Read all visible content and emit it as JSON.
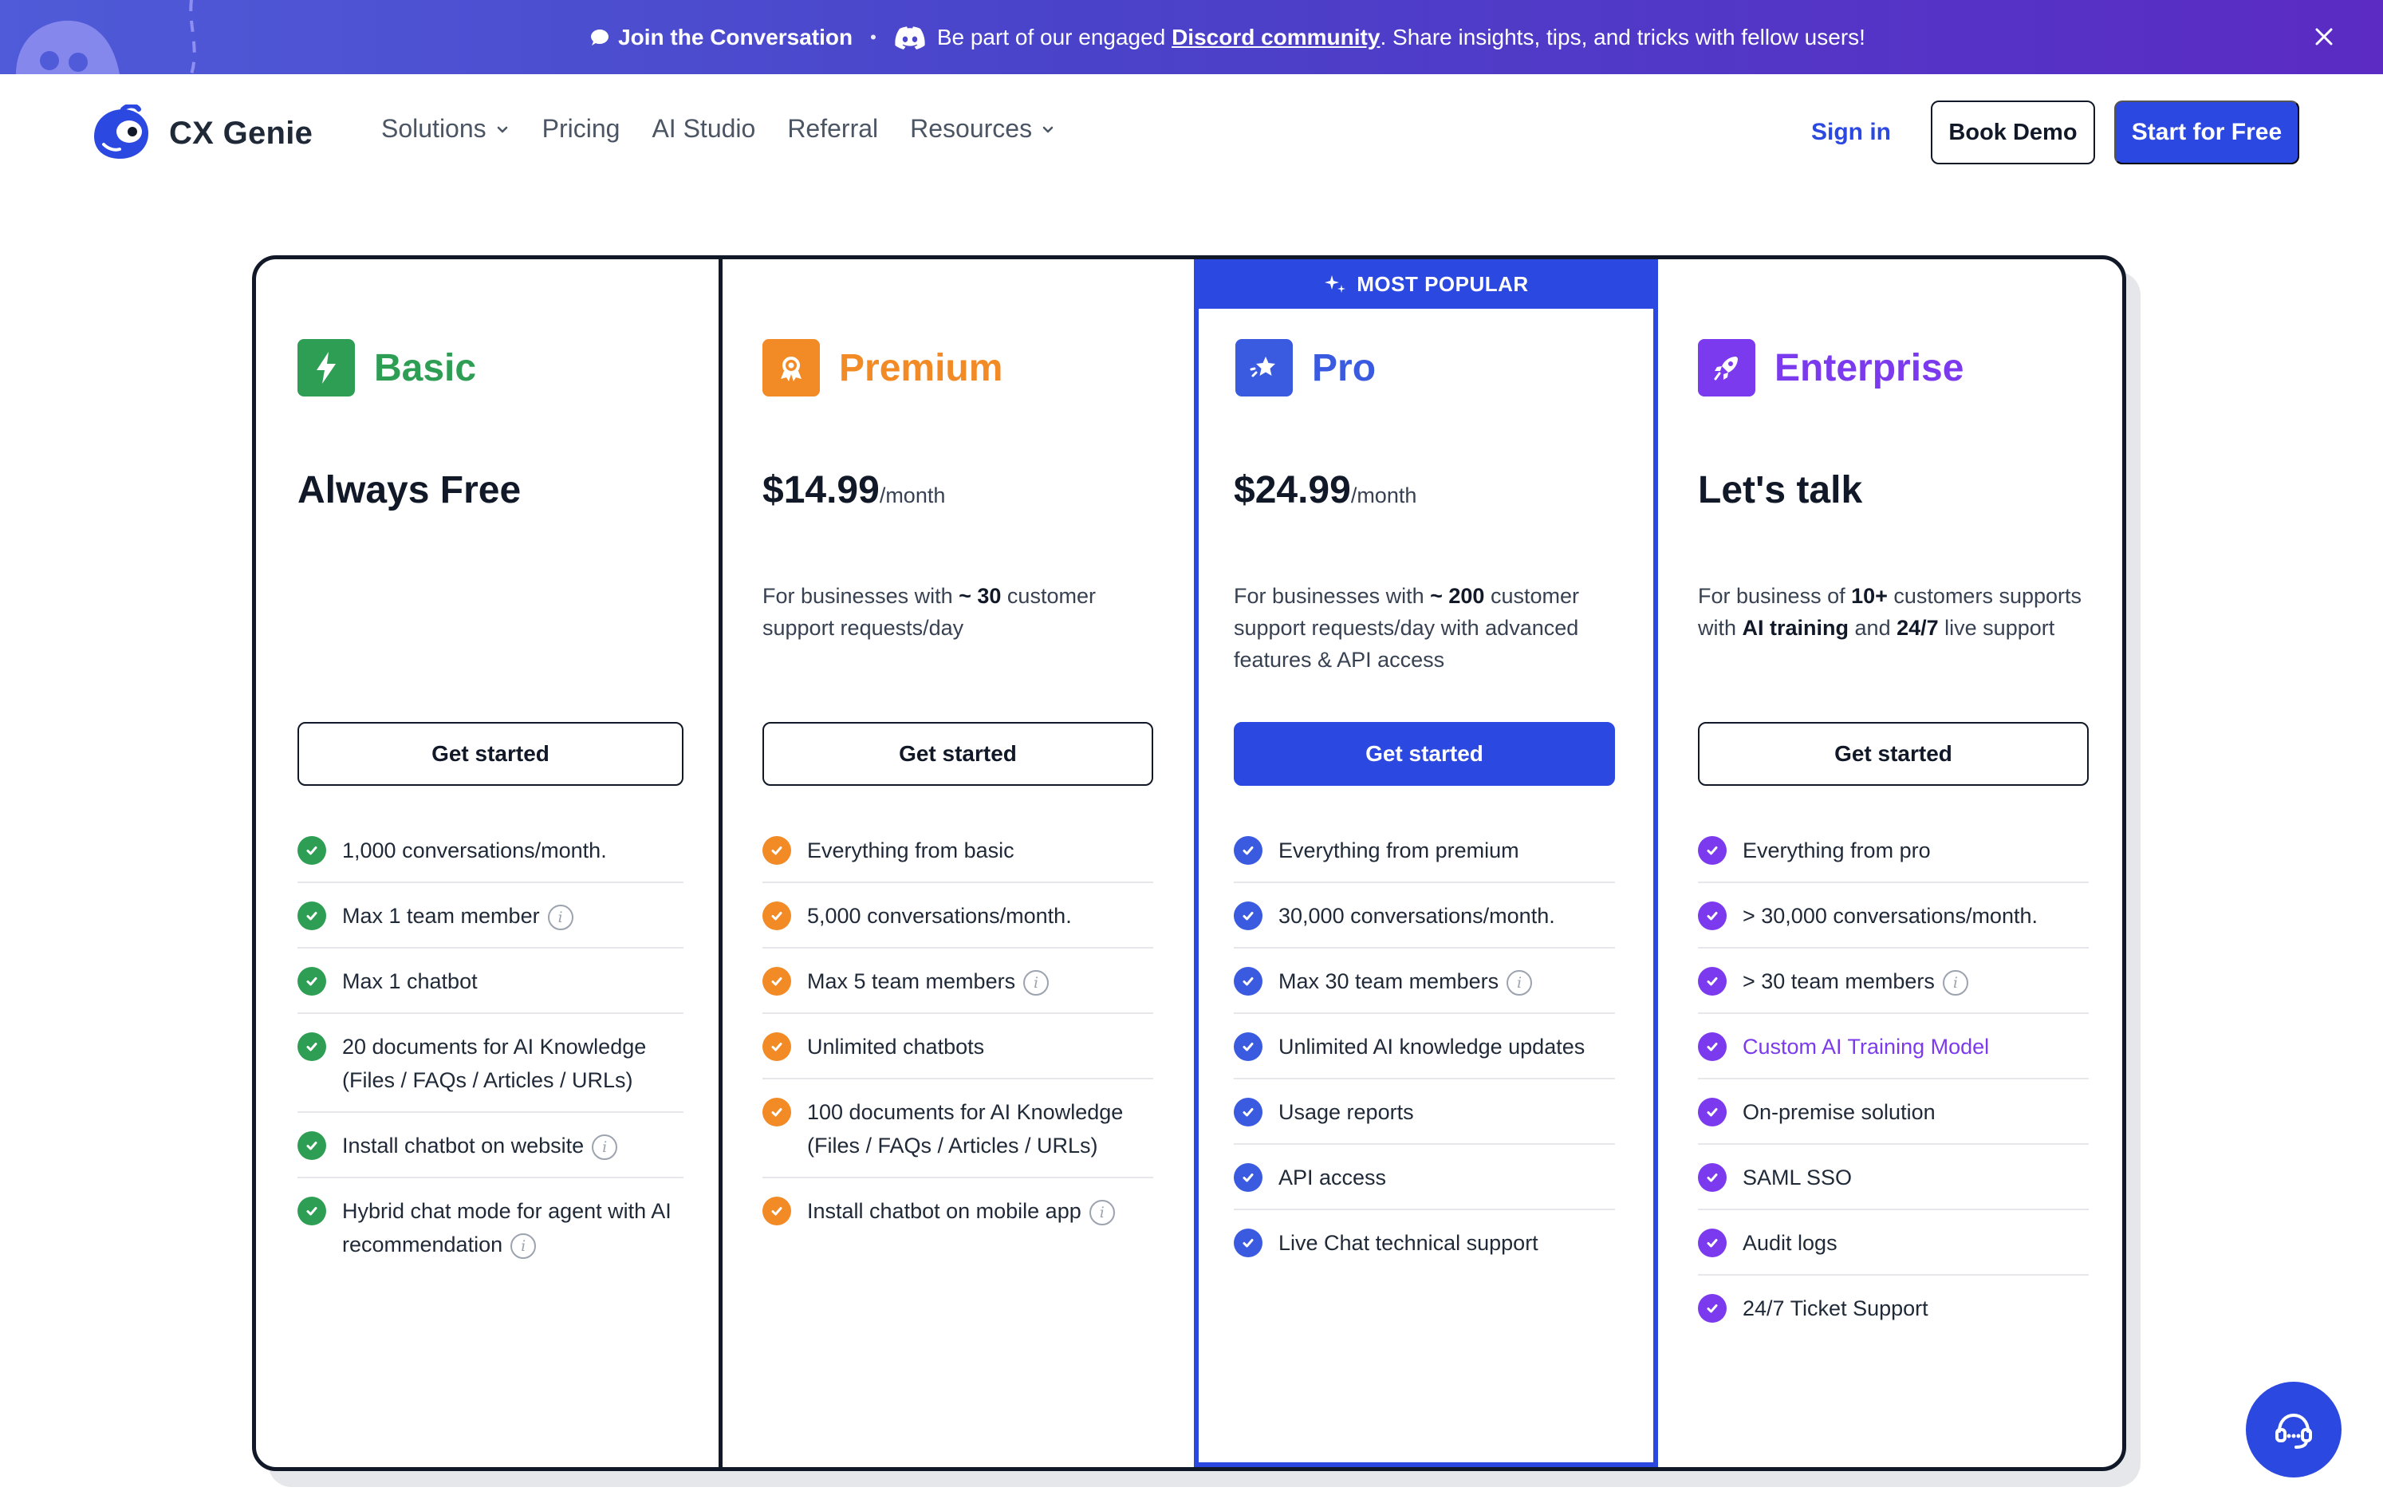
{
  "announcement": {
    "join_text": "Join the Conversation",
    "separator": "•",
    "message_prefix": "Be part of our engaged",
    "discord_link": "Discord community",
    "message_suffix": ". Share insights, tips, and tricks with fellow users!",
    "chat_icon": "speech-bubble-icon",
    "discord_icon": "discord-icon",
    "close_icon": "close-icon"
  },
  "header": {
    "logo_text": "CX Genie",
    "nav": [
      {
        "label": "Solutions",
        "has_dropdown": true
      },
      {
        "label": "Pricing",
        "has_dropdown": false
      },
      {
        "label": "AI Studio",
        "has_dropdown": false
      },
      {
        "label": "Referral",
        "has_dropdown": false
      },
      {
        "label": "Resources",
        "has_dropdown": true
      }
    ],
    "sign_in": "Sign in",
    "book_demo": "Book Demo",
    "start_free": "Start for Free"
  },
  "colors": {
    "brand_blue": "#2b48e0",
    "basic_green": "#2f9e55",
    "premium_orange": "#f28a26",
    "pro_blue": "#3a5ae0",
    "enterprise_purple": "#7b3aed"
  },
  "plans": {
    "basic": {
      "name": "Basic",
      "icon": "lightning-bolt-icon",
      "price_text": "Always Free",
      "cta": "Get started",
      "features": [
        {
          "text": "1,000 conversations/month.",
          "info": false
        },
        {
          "text": "Max 1 team member",
          "info": true
        },
        {
          "text": "Max 1 chatbot",
          "info": false
        },
        {
          "text": "20 documents for AI Knowledge (Files / FAQs / Articles / URLs)",
          "info": false
        },
        {
          "text": "Install chatbot on website",
          "info": true
        },
        {
          "text": "Hybrid chat mode for agent with AI recommendation",
          "info": true
        }
      ]
    },
    "premium": {
      "name": "Premium",
      "icon": "premium-badge-icon",
      "price": "$14.99",
      "per": "/month",
      "desc_pre": "For businesses with ",
      "desc_bold": "~ 30",
      "desc_post": " customer support requests/day",
      "cta": "Get started",
      "features": [
        {
          "text": "Everything from basic",
          "info": false
        },
        {
          "text": "5,000 conversations/month.",
          "info": false
        },
        {
          "text": "Max 5 team members",
          "info": true
        },
        {
          "text": "Unlimited chatbots",
          "info": false
        },
        {
          "text": "100 documents for AI Knowledge (Files / FAQs / Articles / URLs)",
          "info": false
        },
        {
          "text": "Install chatbot on mobile app",
          "info": true
        }
      ]
    },
    "pro": {
      "badge": "MOST POPULAR",
      "name": "Pro",
      "icon": "star-badge-icon",
      "price": "$24.99",
      "per": "/month",
      "desc_pre": "For businesses with ",
      "desc_bold": "~ 200",
      "desc_post": " customer support requests/day with advanced features & API access",
      "cta": "Get started",
      "features": [
        {
          "text": "Everything from premium",
          "info": false
        },
        {
          "text": "30,000 conversations/month.",
          "info": false
        },
        {
          "text": "Max 30 team members",
          "info": true
        },
        {
          "text": "Unlimited AI knowledge updates",
          "info": false
        },
        {
          "text": "Usage reports",
          "info": false
        },
        {
          "text": "API access",
          "info": false
        },
        {
          "text": "Live Chat technical support",
          "info": false
        }
      ]
    },
    "enterprise": {
      "name": "Enterprise",
      "icon": "rocket-icon",
      "price_text": "Let's talk",
      "desc_1": "For business of ",
      "desc_b1": "10+",
      "desc_2": " customers supports with ",
      "desc_b2": "AI training",
      "desc_3": " and ",
      "desc_b3": "24/7",
      "desc_4": " live support",
      "cta": "Get started",
      "features": [
        {
          "text": "Everything from pro",
          "info": false
        },
        {
          "text": "> 30,000 conversations/month.",
          "info": false
        },
        {
          "text": "> 30 team members",
          "info": true
        },
        {
          "text": "Custom AI Training Model",
          "info": false,
          "link": true
        },
        {
          "text": "On-premise solution",
          "info": false
        },
        {
          "text": "SAML SSO",
          "info": false
        },
        {
          "text": "Audit logs",
          "info": false
        },
        {
          "text": "24/7 Ticket Support",
          "info": false
        }
      ]
    }
  },
  "support_fab_icon": "headset-icon"
}
